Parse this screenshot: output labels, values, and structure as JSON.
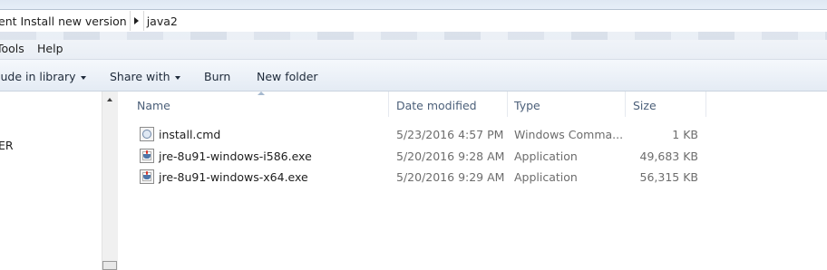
{
  "address_bar": {
    "breadcrumbs": [
      "ent Install new version",
      "java2"
    ]
  },
  "menu": {
    "items": [
      "Tools",
      "Help"
    ]
  },
  "toolbar": {
    "include_in_library": "lude in library",
    "share_with": "Share with",
    "burn": "Burn",
    "new_folder": "New folder"
  },
  "nav_pane": {
    "visible_text": "ER"
  },
  "file_list": {
    "columns": {
      "name": "Name",
      "date_modified": "Date modified",
      "type": "Type",
      "size": "Size"
    },
    "files": [
      {
        "name": "install.cmd",
        "date": "5/23/2016 4:57 PM",
        "type": "Windows Comma...",
        "size": "1 KB",
        "icon": "cmd-file-icon"
      },
      {
        "name": "jre-8u91-windows-i586.exe",
        "date": "5/20/2016 9:28 AM",
        "type": "Application",
        "size": "49,683 KB",
        "icon": "java-exe-icon"
      },
      {
        "name": "jre-8u91-windows-x64.exe",
        "date": "5/20/2016 9:29 AM",
        "type": "Application",
        "size": "56,315 KB",
        "icon": "java-exe-icon"
      }
    ]
  },
  "colors": {
    "toolbar_text": "#1e2a3a",
    "column_header_text": "#4c607a",
    "toolbar_background": "#e4ebf4"
  }
}
